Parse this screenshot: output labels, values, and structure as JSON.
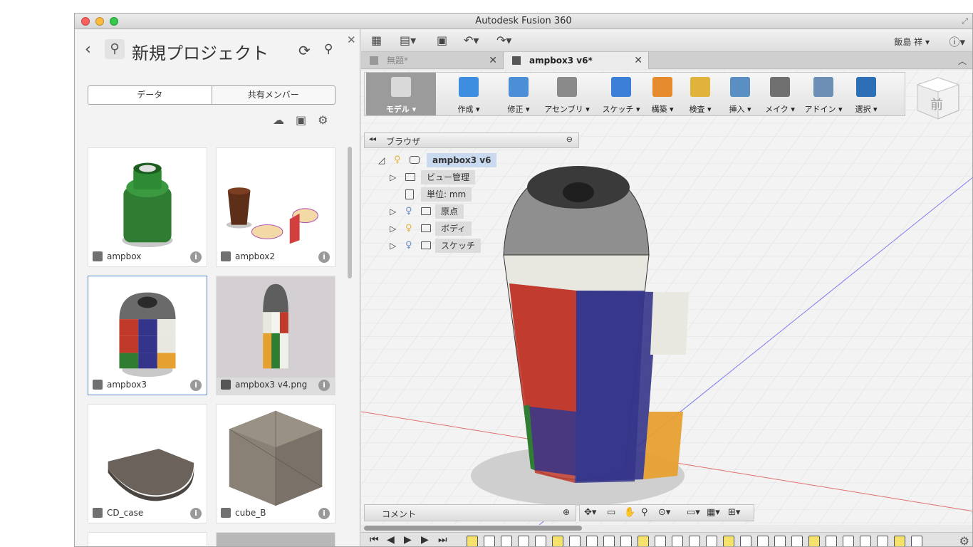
{
  "window": {
    "title": "Autodesk Fusion 360"
  },
  "panel": {
    "title": "新規プロジェクト",
    "tabs": [
      "データ",
      "共有メンバー"
    ],
    "files": [
      {
        "name": "ampbox",
        "type": "design"
      },
      {
        "name": "ampbox2",
        "type": "design"
      },
      {
        "name": "ampbox3",
        "type": "design",
        "selected": true
      },
      {
        "name": "ampbox3 v4.png",
        "type": "image"
      },
      {
        "name": "CD_case",
        "type": "design"
      },
      {
        "name": "cube_B",
        "type": "design"
      }
    ]
  },
  "topbar": {
    "user": "飯島 祥 ▾",
    "help": "?"
  },
  "doc_tabs": [
    {
      "label": "無題*",
      "active": false
    },
    {
      "label": "ampbox3 v6*",
      "active": true
    }
  ],
  "ribbon": [
    {
      "label": "モデル ▾",
      "icon": "model-cube-icon",
      "color": "#d9d9d9"
    },
    {
      "label": "作成 ▾",
      "icon": "box-icon",
      "color": "#3d8ee0"
    },
    {
      "label": "修正 ▾",
      "icon": "press-pull-icon",
      "color": "#4d8fd6"
    },
    {
      "label": "アセンブリ ▾",
      "icon": "joint-icon",
      "color": "#8a8a8a"
    },
    {
      "label": "スケッチ ▾",
      "icon": "sketch-curve-icon",
      "color": "#3b7fd9"
    },
    {
      "label": "構築 ▾",
      "icon": "plane-icon",
      "color": "#e58b2e"
    },
    {
      "label": "検査 ▾",
      "icon": "ruler-icon",
      "color": "#e0b43a"
    },
    {
      "label": "挿入 ▾",
      "icon": "image-icon",
      "color": "#5a8fc4"
    },
    {
      "label": "メイク ▾",
      "icon": "printer-icon",
      "color": "#707070"
    },
    {
      "label": "アドイン ▾",
      "icon": "addin-icon",
      "color": "#6d8fb5"
    },
    {
      "label": "選択 ▾",
      "icon": "select-cursor-icon",
      "color": "#2c6fb6"
    }
  ],
  "viewcube": {
    "face": "前"
  },
  "browser": {
    "title": "ブラウザ",
    "root": "ampbox3 v6",
    "nodes": [
      "ビュー管理",
      "単位: mm",
      "原点",
      "ボディ",
      "スケッチ"
    ]
  },
  "comment": {
    "title": "コメント"
  },
  "colors": {
    "accent": "#3b7fd9",
    "selection": "#5b87c6"
  }
}
